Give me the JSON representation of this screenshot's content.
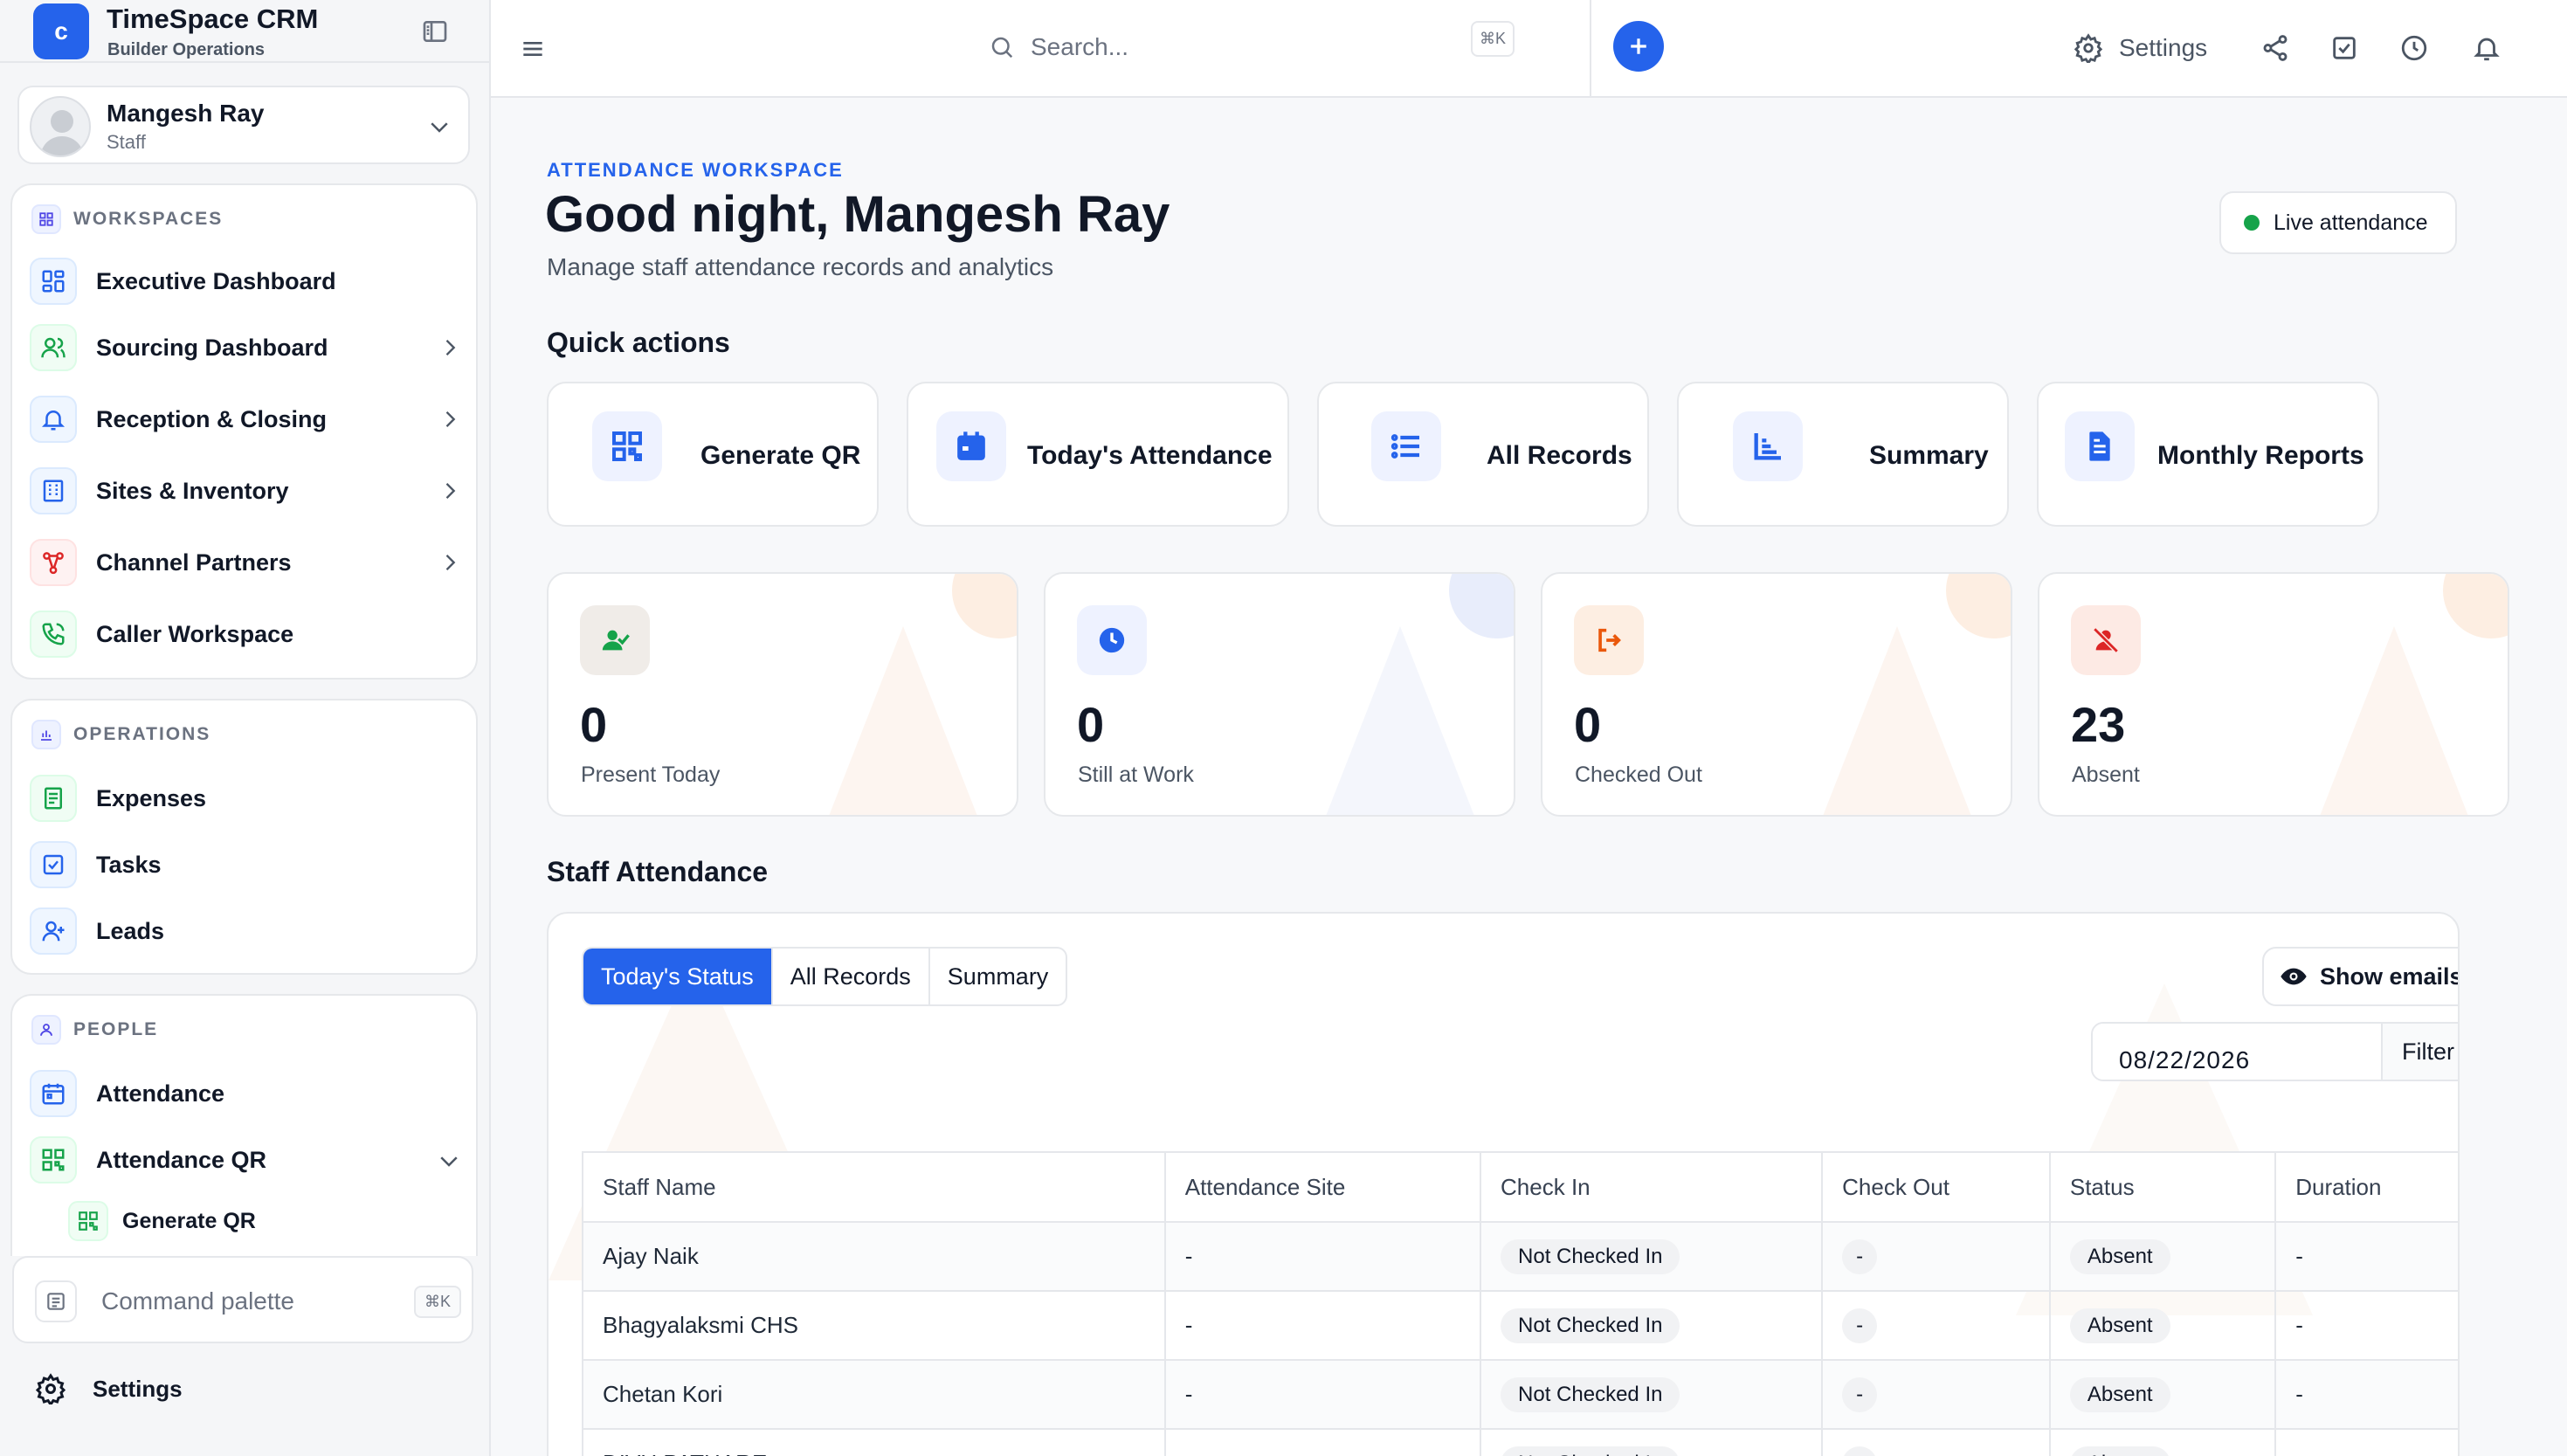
{
  "brand": {
    "logo_letter": "c",
    "title": "TimeSpace CRM",
    "subtitle": "Builder Operations"
  },
  "user": {
    "name": "Mangesh Ray",
    "role": "Staff"
  },
  "workspaces": {
    "label": "WORKSPACES",
    "items": [
      {
        "label": "Executive Dashboard",
        "icon": "dashboard-grid-icon"
      },
      {
        "label": "Sourcing Dashboard",
        "icon": "users-icon"
      },
      {
        "label": "Reception & Closing",
        "icon": "bell-icon"
      },
      {
        "label": "Sites & Inventory",
        "icon": "building-icon"
      },
      {
        "label": "Channel Partners",
        "icon": "network-icon"
      },
      {
        "label": "Caller Workspace",
        "icon": "phone-icon"
      }
    ]
  },
  "operations": {
    "label": "OPERATIONS",
    "items": [
      {
        "label": "Expenses",
        "icon": "receipt-icon"
      },
      {
        "label": "Tasks",
        "icon": "checkbox-icon"
      },
      {
        "label": "Leads",
        "icon": "user-plus-icon"
      }
    ]
  },
  "people": {
    "label": "PEOPLE",
    "items": [
      {
        "label": "Attendance",
        "icon": "calendar-icon"
      },
      {
        "label": "Attendance QR",
        "icon": "qr-icon"
      }
    ],
    "subitems": [
      {
        "label": "Generate QR",
        "icon": "qr-icon"
      }
    ]
  },
  "command": {
    "label": "Command palette",
    "shortcut": "⌘K"
  },
  "sidebar_settings": {
    "label": "Settings"
  },
  "topbar": {
    "search_placeholder": "Search...",
    "search_shortcut": "⌘K",
    "settings_label": "Settings"
  },
  "header": {
    "eyebrow": "ATTENDANCE WORKSPACE",
    "greeting": "Good night, Mangesh Ray",
    "subtitle": "Manage staff attendance records and analytics",
    "live_label": "Live attendance"
  },
  "quick_actions": {
    "title": "Quick actions",
    "items": [
      {
        "label": "Generate QR",
        "icon": "qr-icon"
      },
      {
        "label": "Today's Attendance",
        "icon": "calendar-icon"
      },
      {
        "label": "All Records",
        "icon": "list-icon"
      },
      {
        "label": "Summary",
        "icon": "chart-icon"
      },
      {
        "label": "Monthly Reports",
        "icon": "report-icon"
      }
    ]
  },
  "stats": [
    {
      "value": "0",
      "label": "Present Today",
      "icon": "user-check-icon",
      "color": "#16a34a"
    },
    {
      "value": "0",
      "label": "Still at Work",
      "icon": "clock-icon",
      "color": "#2563eb"
    },
    {
      "value": "0",
      "label": "Checked Out",
      "icon": "logout-icon",
      "color": "#ea580c"
    },
    {
      "value": "23",
      "label": "Absent",
      "icon": "user-x-icon",
      "color": "#dc2626"
    }
  ],
  "staff": {
    "title": "Staff Attendance",
    "tabs": [
      "Today's Status",
      "All Records",
      "Summary"
    ],
    "active_tab": "Today's Status",
    "show_emails_label": "Show emails",
    "date_value": "08/22/2026",
    "filter_label": "Filter",
    "columns": [
      "Staff Name",
      "Attendance Site",
      "Check In",
      "Check Out",
      "Status",
      "Duration"
    ],
    "rows": [
      [
        "Ajay Naik",
        "-",
        "Not Checked In",
        "-",
        "Absent",
        "-"
      ],
      [
        "Bhagyalaksmi CHS",
        "-",
        "Not Checked In",
        "-",
        "Absent",
        "-"
      ],
      [
        "Chetan Kori",
        "-",
        "Not Checked In",
        "-",
        "Absent",
        "-"
      ],
      [
        "DIVU PATHARE",
        "-",
        "Not Checked In",
        "-",
        "Absent",
        "-"
      ]
    ]
  },
  "colors": {
    "accent": "#2563eb",
    "live": "#16a34a"
  }
}
